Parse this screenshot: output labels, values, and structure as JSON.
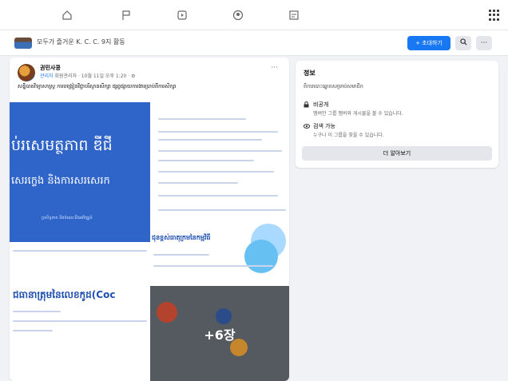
{
  "topnav": {
    "icons": [
      "home-icon",
      "flag-icon",
      "play-icon",
      "groups-icon",
      "news-icon",
      "menu-grid-icon"
    ]
  },
  "group": {
    "name": "모두가 즐거운 K. C. C. 9지 활동",
    "invite_label": "+ 초대하기",
    "search_icon": "search-icon",
    "more_label": "···"
  },
  "post": {
    "author": "권민사콩",
    "badge": "관리자",
    "meta": "회원관리자 · 10월 11일 오후 1:20 · ⚙",
    "more_label": "···",
    "text": "សន្និបាតវិទ្យាសាស្ត្រ ការបង្រៀនវិជ្ជាបរិស្ថានសិក្សា ផ្សព្វផ្សាយការងារប្រាប់ពីការសិក្សា",
    "image1_big1": "ប់រសេមត្ថភាព ឌីជី",
    "image1_big2": "សេរក្ខេង និងការសរសេរក",
    "image1_small": "ប្រសិទ្ធភាព និងចំណេះដឹងអភិវឌ្ឍន៍",
    "image2_heading": "ជុនខ្ពស់ធាតុក្រមនៃកម្មវិធី",
    "image3_heading": "ជធានាត្រុមនៃលេខកូដ(Coc",
    "more_count": "+6장"
  },
  "info": {
    "title": "정보",
    "desc": "ពិការបោះឆ្នោតសម្រាប់សមាជិក",
    "privacy_title": "비공개",
    "privacy_sub": "멤버만 그룹 멤버와 게시물을 볼 수 있습니다.",
    "visible_title": "검색 가능",
    "visible_sub": "누구나 이 그룹을 찾을 수 있습니다.",
    "learn_more": "더 알아보기"
  },
  "colors": {
    "accent": "#1877f2",
    "image_blue": "#2f64c9",
    "overlay_gray": "#555a61"
  }
}
